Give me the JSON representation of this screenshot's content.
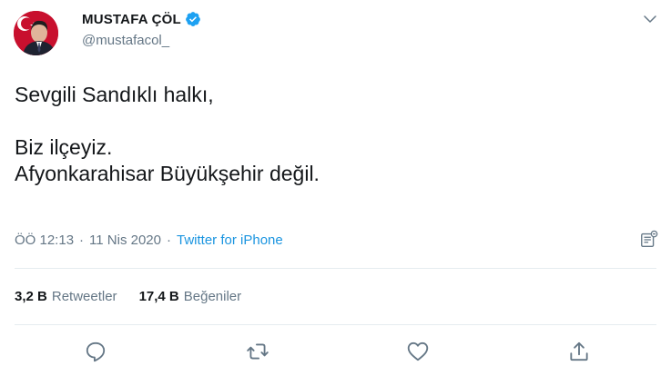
{
  "tweet": {
    "author": {
      "display_name": "MUSTAFA ÇÖL",
      "handle": "@mustafacol_",
      "verified": true
    },
    "text": "Sevgili Sandıklı halkı,\n\nBiz ilçeyiz.\nAfyonkarahisar Büyükşehir değil.",
    "time": "ÖÖ 12:13",
    "date": "11 Nis 2020",
    "separator": "·",
    "source": "Twitter for iPhone"
  },
  "stats": {
    "retweets_count": "3,2 B",
    "retweets_label": "Retweetler",
    "likes_count": "17,4 B",
    "likes_label": "Beğeniler"
  },
  "icons": {
    "verified": "verified-badge-icon",
    "caret": "chevron-down-icon",
    "analytics": "tweet-analytics-icon",
    "reply": "reply-icon",
    "retweet": "retweet-icon",
    "like": "heart-icon",
    "share": "share-icon"
  },
  "colors": {
    "text": "#14171a",
    "muted": "#657786",
    "link": "#1b95e0",
    "verified": "#1da1f2",
    "divider": "#e6ecf0",
    "flag_red": "#e30a17"
  }
}
